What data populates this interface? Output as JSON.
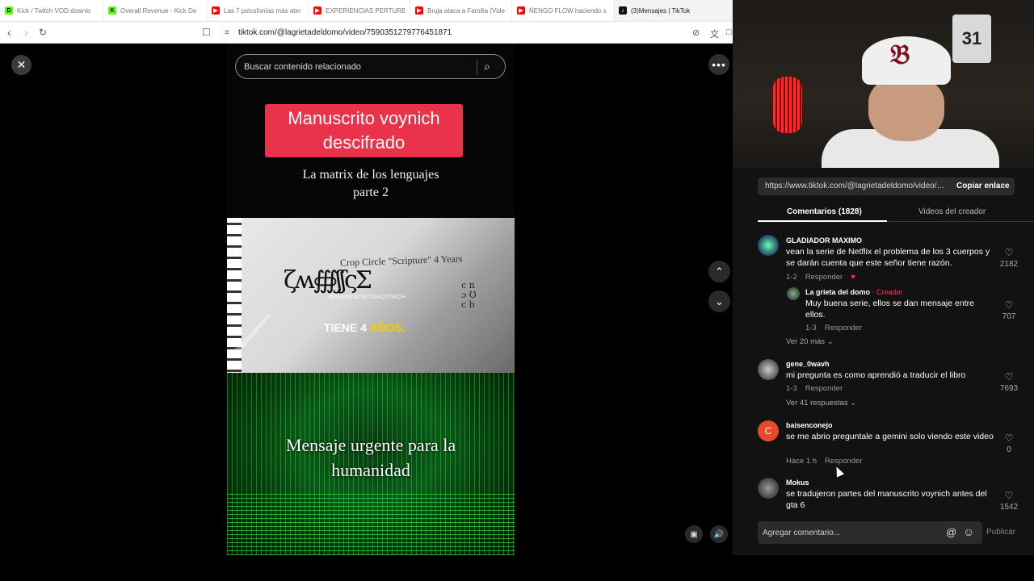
{
  "browser": {
    "tabs": [
      {
        "label": "Kick / Twitch VOD downlo",
        "color": "#53fc18",
        "glyph": "D"
      },
      {
        "label": "Overall Revenue - Kick De",
        "color": "#53fc18",
        "glyph": "K"
      },
      {
        "label": "Las 7 psicofonías más ater",
        "color": "#ff0000",
        "glyph": "▶"
      },
      {
        "label": "EXPERIENCIAS PERTURBA",
        "color": "#ff0000",
        "glyph": "▶"
      },
      {
        "label": "Bruja ataca a Familia (Vide",
        "color": "#ff0000",
        "glyph": "▶"
      },
      {
        "label": "ÑENGO FLOW haciendo s",
        "color": "#ff0000",
        "glyph": "▶"
      },
      {
        "label": "(3)Mensajes | TikTok",
        "color": "#111111",
        "glyph": "♪"
      }
    ],
    "url": "tiktok.com/@lagrietadeldomo/video/7590351279776451871",
    "icons": {
      "back": "back-icon",
      "forward": "forward-icon",
      "reload": "reload-icon",
      "bookmark": "bookmark-icon",
      "site": "site-settings-icon",
      "translate": "translate-icon"
    }
  },
  "video": {
    "search_placeholder": "Buscar contenido relacionado",
    "title_line1": "Manuscrito voynich",
    "title_line2": "descifrado",
    "subtitle_line1": "La matrix de los lenguajes",
    "subtitle_line2": "parte 2",
    "paper_text": "Crop Circle \"Scripture\" 4 Years",
    "watermark": "@MANUSCRITOVOYNICH",
    "caption_a": "TIENE 4",
    "caption_b": "AÑOS.",
    "side_watermark": "@lagrietadeldomo",
    "urgent_line1": "Mensaje urgente para la",
    "urgent_line2": "humanidad",
    "accent": "#e8334a"
  },
  "panel": {
    "link": "https://www.tiktok.com/@lagrietadeldomo/video/7...",
    "copy_label": "Copiar enlace",
    "tab_comments": "Comentarios (1828)",
    "tab_videos": "Videos del creador",
    "comments": [
      {
        "user": "GLADIADOR MAXIMO",
        "text": "vean la serie de Netflix el problema de los 3 cuerpos y se darán cuenta que este señor tiene razón.",
        "date": "1-2",
        "reply": "Responder",
        "likes": "2182"
      },
      {
        "user": "La grieta del domo",
        "creator": "· Creador",
        "text": "Muy buena serie, ellos se dan mensaje entre ellos.",
        "date": "1-3",
        "reply": "Responder",
        "likes": "707"
      },
      {
        "user": "gene_0wavh",
        "text": "mi pregunta es como aprendió a traducir el libro",
        "date": "1-3",
        "reply": "Responder",
        "likes": "7693"
      },
      {
        "user": "baisenconejo",
        "avatar_letter": "C",
        "text": "se me abrio preguntale a gemini solo viendo este video",
        "date": "Hace 1 h",
        "reply": "Responder",
        "likes": "0"
      },
      {
        "user": "Mokus",
        "text": "se tradujeron partes del manuscrito voynich antes del gta 6",
        "likes": "1542"
      }
    ],
    "view_more_1": "Ver 20 más",
    "view_more_2": "Ver 41 respuestas",
    "add_comment_placeholder": "Agregar comentario...",
    "publish_label": "Publicar"
  },
  "webcam": {
    "jersey_number": "31"
  }
}
